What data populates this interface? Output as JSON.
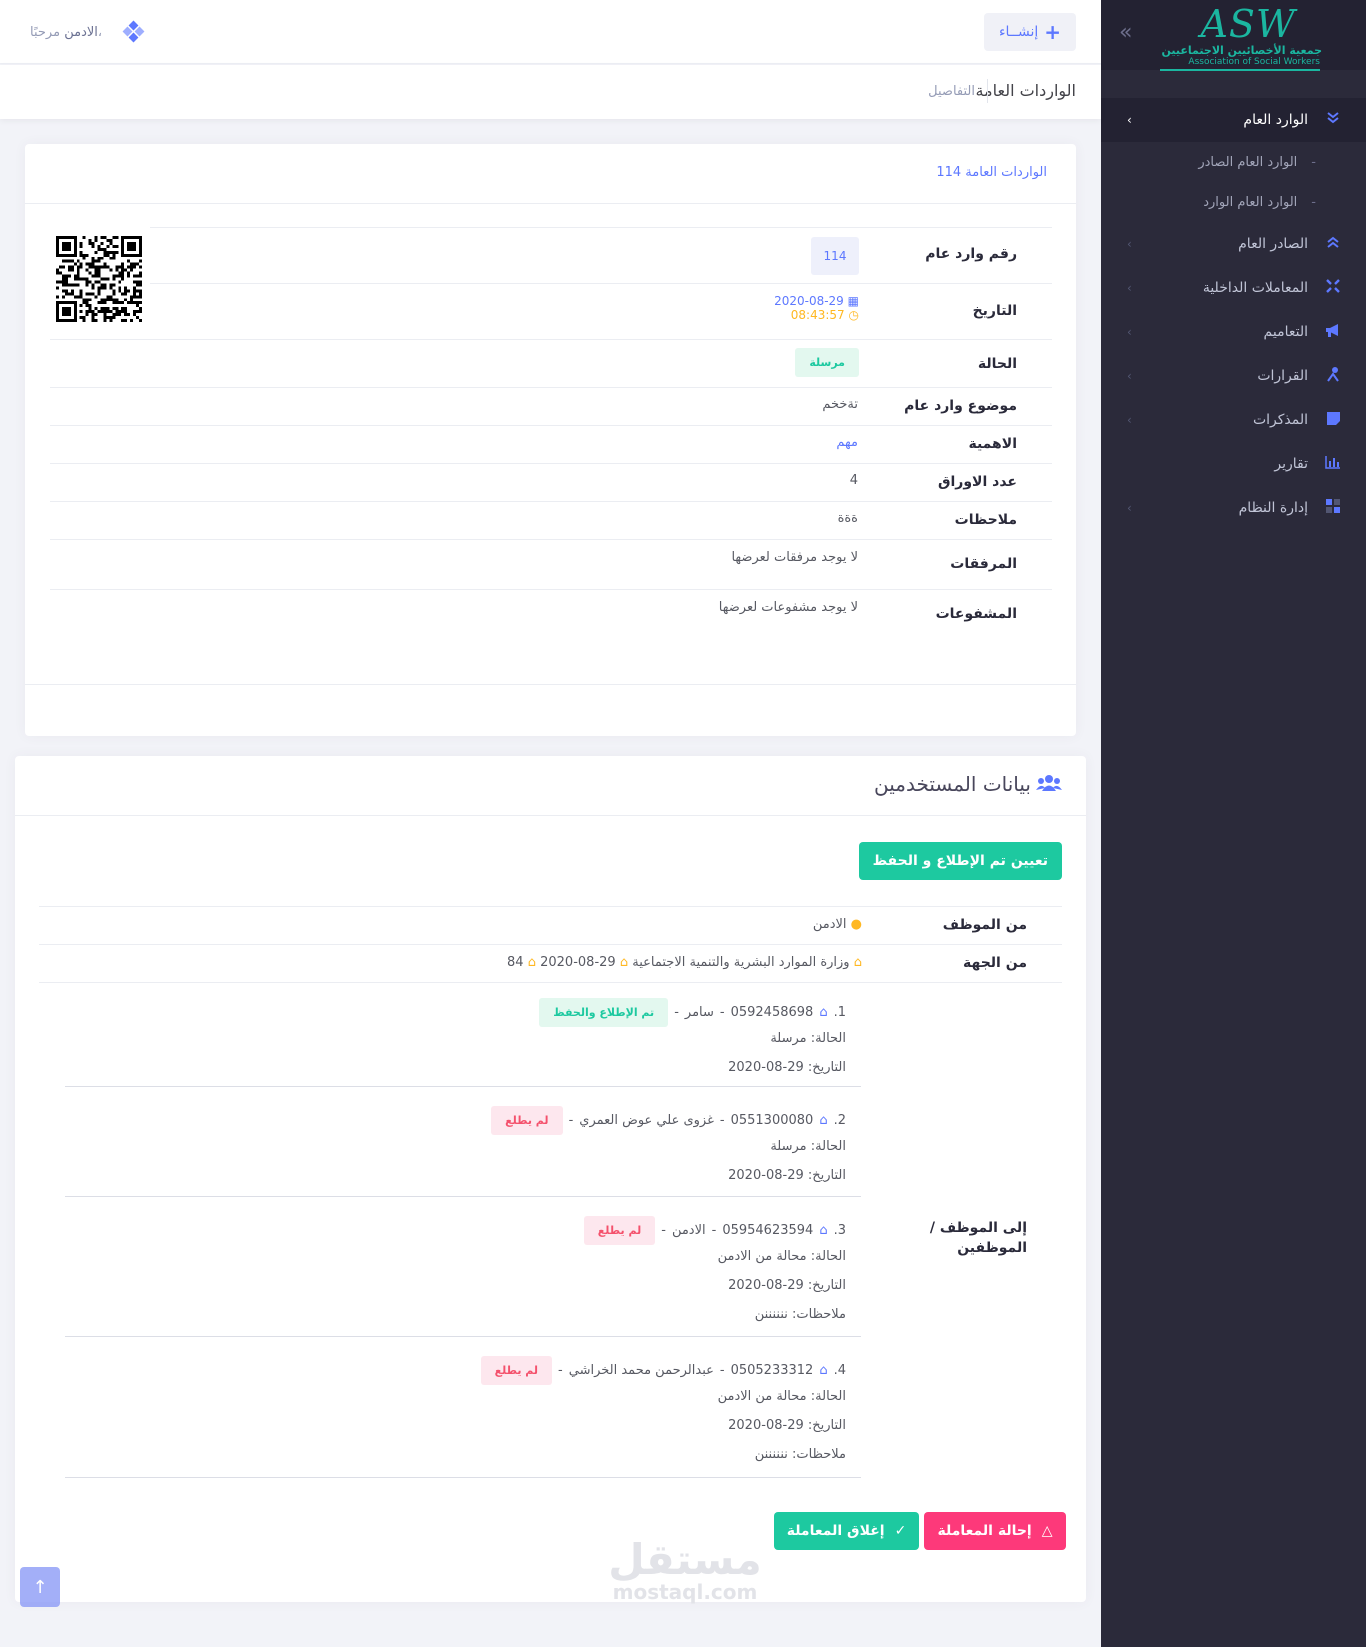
{
  "header": {
    "create_label": "إنشــاء",
    "greeting": "مرحبًا،",
    "username": "الادمن"
  },
  "subheader": {
    "title": "الواردات العامة",
    "desc": "التفاصيل"
  },
  "sidebar": {
    "logo": {
      "mark": "ASW",
      "ar": "جمعية الأخصائيين الاجتماعيين",
      "en": "Association of Social Workers"
    },
    "items": [
      {
        "label": "الوارد العام",
        "icon": "double-chevron-down-icon"
      },
      {
        "label": "الصادر العام",
        "icon": "double-chevron-up-icon"
      },
      {
        "label": "المعاملات الداخلية",
        "icon": "arrows-icon"
      },
      {
        "label": "التعاميم",
        "icon": "megaphone-icon"
      },
      {
        "label": "القرارات",
        "icon": "gavel-icon"
      },
      {
        "label": "المذكرات",
        "icon": "note-icon"
      },
      {
        "label": "تقارير",
        "icon": "bar-chart-icon"
      },
      {
        "label": "إدارة النظام",
        "icon": "grid-icon"
      }
    ],
    "subitems": [
      {
        "label": "الوارد العام الصادر"
      },
      {
        "label": "الوارد العام الوارد"
      }
    ]
  },
  "details": {
    "card_title": "الواردات العامة 114",
    "rows": {
      "number": {
        "label": "رقم وارد عام",
        "value": "114"
      },
      "date": {
        "label": "التاريخ",
        "date": "2020-08-29",
        "time": "08:43:57"
      },
      "status": {
        "label": "الحالة",
        "value": "مرسلة"
      },
      "subject": {
        "label": "موضوع وارد عام",
        "value": "تةخخم"
      },
      "priority": {
        "label": "الاهمية",
        "value": "مهم"
      },
      "pages": {
        "label": "عدد الاوراق",
        "value": "4"
      },
      "notes": {
        "label": "ملاحظات",
        "value": "ةةة"
      },
      "attachments": {
        "label": "المرفقات",
        "value": "لا يوجد مرفقات لعرضها"
      },
      "scans": {
        "label": "المشفوعات",
        "value": "لا يوجد مشفوعات لعرضها"
      }
    }
  },
  "users": {
    "title": "بيانات المستخدمين",
    "assign_label": "تعيين تم الإطلاع و الحفظ",
    "from_employee": {
      "label": "من الموظف",
      "value": "الادمن"
    },
    "from_entity": {
      "label": "من الجهة",
      "entity": "وزارة الموارد البشرية والتنمية الاجتماعية",
      "date": "29-08-2020",
      "number": "84"
    },
    "to_label": "إلى الموظف / الموظفين",
    "recipients": [
      {
        "index": "1.",
        "phone": "0592458698",
        "name": "سامر",
        "badge": "تم الإطلاع والحفظ",
        "status": "الحالة: مرسلة",
        "date": "التاريخ: 29-08-2020",
        "notes": ""
      },
      {
        "index": "2.",
        "phone": "0551300080",
        "name": "غزوى علي عوض العمري",
        "badge": "لم يطلع",
        "status": "الحالة: مرسلة",
        "date": "التاريخ: 29-08-2020",
        "notes": ""
      },
      {
        "index": "3.",
        "phone": "05954623594",
        "name": "الادمن",
        "badge": "لم يطلع",
        "status": "الحالة: محالة من الادمن",
        "date": "التاريخ: 29-08-2020",
        "notes": "ملاحظات: ننننننن"
      },
      {
        "index": "4.",
        "phone": "0505233312",
        "name": "عبدالرحمن محمد الخراشي",
        "badge": "لم يطلع",
        "status": "الحالة: محالة من الادمن",
        "date": "التاريخ: 29-08-2020",
        "notes": "ملاحظات: ننننننن"
      }
    ],
    "refer_label": "إحالة المعاملة",
    "close_label": "إغلاق المعاملة"
  },
  "watermark": {
    "ar": "مستقل",
    "en": "mostaql.com"
  },
  "colors": {
    "primary": "#5d78ff",
    "success": "#1dc9a0",
    "danger": "#fd397a",
    "warning": "#ffb822",
    "sidebar": "#2b2a3a"
  }
}
